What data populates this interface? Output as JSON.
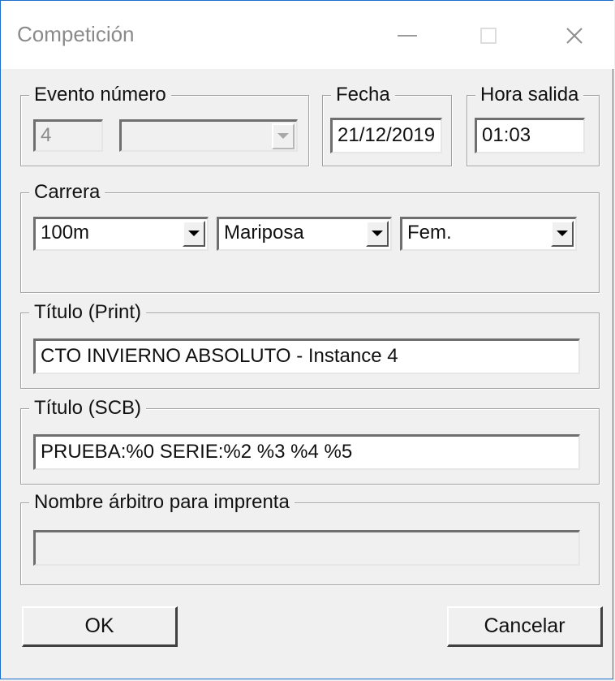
{
  "window": {
    "title": "Competición"
  },
  "evento": {
    "legend": "Evento número",
    "number_value": "4",
    "select_value": ""
  },
  "fecha": {
    "legend": "Fecha",
    "value": "21/12/2019"
  },
  "hora": {
    "legend": "Hora salida",
    "value": "01:03"
  },
  "carrera": {
    "legend": "Carrera",
    "distance": "100m",
    "style": "Mariposa",
    "category": "Fem."
  },
  "titulo_print": {
    "legend": "Título (Print)",
    "value": "CTO INVIERNO ABSOLUTO - Instance 4"
  },
  "titulo_scb": {
    "legend": "Título (SCB)",
    "value": "PRUEBA:%0 SERIE:%2 %3 %4 %5"
  },
  "arbitro": {
    "legend": "Nombre árbitro para imprenta",
    "value": ""
  },
  "buttons": {
    "ok": "OK",
    "cancel": "Cancelar"
  }
}
